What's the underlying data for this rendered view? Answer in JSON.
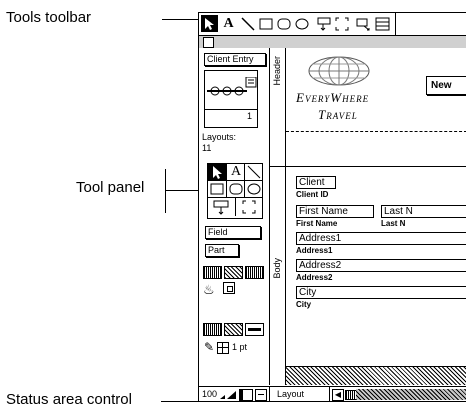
{
  "callouts": {
    "tools_toolbar": "Tools toolbar",
    "tool_panel": "Tool panel",
    "status_area_control": "Status area control"
  },
  "toolbar": {
    "icons": [
      "pointer-tool-icon",
      "text-tool-icon",
      "line-tool-icon",
      "rectangle-tool-icon",
      "rounded-rectangle-tool-icon",
      "oval-tool-icon",
      "button-tool-icon",
      "portal-tool-icon",
      "field-tool-icon",
      "part-tool-icon"
    ],
    "text_tool_label": "A"
  },
  "status_area": {
    "layout_menu_label": "Client Entry",
    "page_number": "1",
    "layouts_label": "Layouts:",
    "layouts_count": "11",
    "text_tool_label": "A",
    "field_button": "Field",
    "part_button": "Part",
    "line_width": "1 pt"
  },
  "parts": {
    "header": "Header",
    "body": "Body"
  },
  "layout": {
    "new_button": "New",
    "company_line1": "EveryWhere",
    "company_line2": "Travel",
    "fields": [
      {
        "value": "Client",
        "label": "Client ID"
      },
      {
        "value": "First Name",
        "label": "First Name"
      },
      {
        "value": "Last N",
        "label": "Last N"
      },
      {
        "value": "Address1",
        "label": "Address1"
      },
      {
        "value": "Address2",
        "label": "Address2"
      },
      {
        "value": "City",
        "label": "City"
      }
    ]
  },
  "bottom_bar": {
    "zoom": "100",
    "mode": "Layout"
  }
}
